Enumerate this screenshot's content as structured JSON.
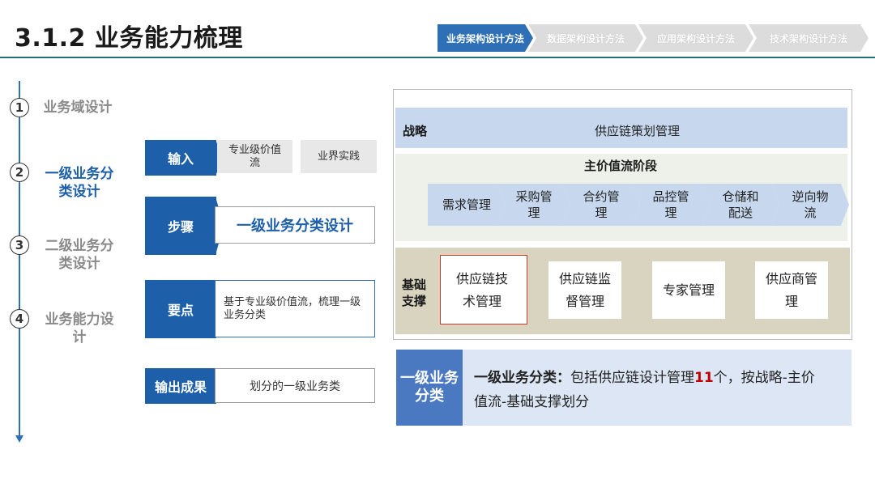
{
  "header": {
    "title": "3.1.2 业务能力梳理",
    "tabs": [
      "业务架构设计方法",
      "数据架构设计方法",
      "应用架构设计方法",
      "技术架构设计方法"
    ],
    "colors": {
      "accent": "#1d5fa8",
      "rule": "#1f6f74"
    }
  },
  "steps": [
    {
      "num": "1",
      "label": "业务域设计"
    },
    {
      "num": "2",
      "label_line1": "一级业务分",
      "label_line2": "类设计"
    },
    {
      "num": "3",
      "label_line1": "二级业务分",
      "label_line2": "类设计"
    },
    {
      "num": "4",
      "label_line1": "业务能力设",
      "label_line2": "计"
    }
  ],
  "process": {
    "input": {
      "head": "输入",
      "item1_line1": "专业级价值",
      "item1_line2": "流",
      "item2": "业界实践"
    },
    "step": {
      "head": "步骤",
      "content": "一级业务分类设计"
    },
    "key": {
      "head": "要点",
      "content_line1": "基于专业级价值流，梳理一级",
      "content_line2": "业务分类"
    },
    "output": {
      "head": "输出成果",
      "content": "划分的一级业务类"
    }
  },
  "framework": {
    "strategy": {
      "label": "战略",
      "text": "供应链策划管理"
    },
    "value_chain": {
      "title": "主价值流阶段",
      "items": [
        {
          "l1": "需求管理",
          "l2": ""
        },
        {
          "l1": "采购管",
          "l2": "理"
        },
        {
          "l1": "合约管",
          "l2": "理"
        },
        {
          "l1": "品控管",
          "l2": "理"
        },
        {
          "l1": "仓储和",
          "l2": "配送"
        },
        {
          "l1": "逆向物",
          "l2": "流"
        }
      ]
    },
    "support": {
      "label_line1": "基础",
      "label_line2": "支撑",
      "cards": [
        {
          "l1": "供应链技",
          "l2": "术管理"
        },
        {
          "l1": "供应链监",
          "l2": "督管理"
        },
        {
          "l1": "专家管理",
          "l2": ""
        },
        {
          "l1": "供应商管",
          "l2": "理"
        }
      ]
    }
  },
  "summary": {
    "label_line1": "一级业务",
    "label_line2": "分类",
    "lead": "一级业务分类：",
    "text_a": "包括供应链设计管理",
    "count": "11",
    "text_b": "个，按战略-主价",
    "text_c": "值流-基础支撑划分"
  }
}
